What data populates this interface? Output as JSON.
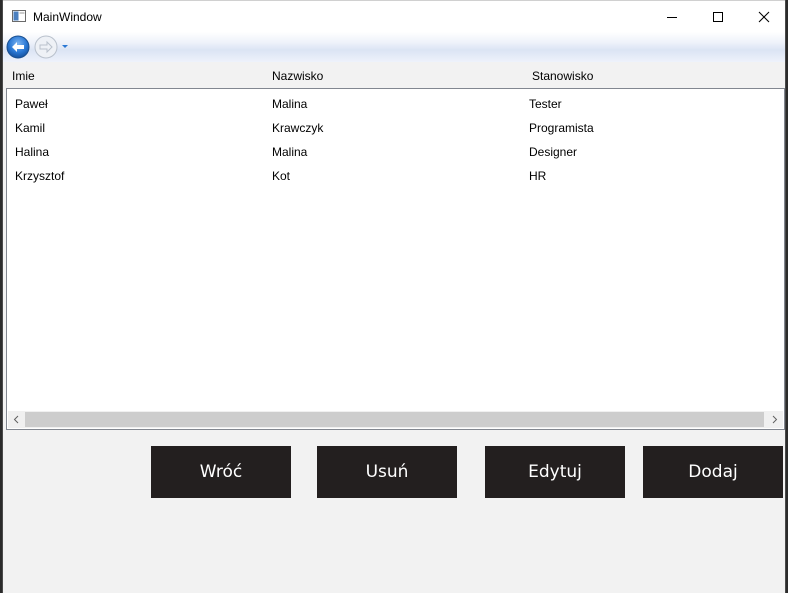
{
  "window": {
    "title": "MainWindow"
  },
  "navigation": {
    "back_icon": "back-arrow-icon",
    "forward_icon": "forward-arrow-icon",
    "history_icon": "chevron-down-icon"
  },
  "table": {
    "columns": [
      "Imie",
      "Nazwisko",
      "Stanowisko"
    ],
    "rows": [
      [
        "Paweł",
        "Malina",
        "Tester"
      ],
      [
        "Kamil",
        "Krawczyk",
        "Programista"
      ],
      [
        "Halina",
        "Malina",
        "Designer"
      ],
      [
        "Krzysztof",
        "Kot",
        "HR"
      ]
    ]
  },
  "actions": {
    "back": "Wróć",
    "delete": "Usuń",
    "edit": "Edytuj",
    "add": "Dodaj"
  },
  "colors": {
    "button_bg": "#231f1f",
    "button_text": "#ffffff",
    "nav_accent": "#1c6fd1"
  }
}
